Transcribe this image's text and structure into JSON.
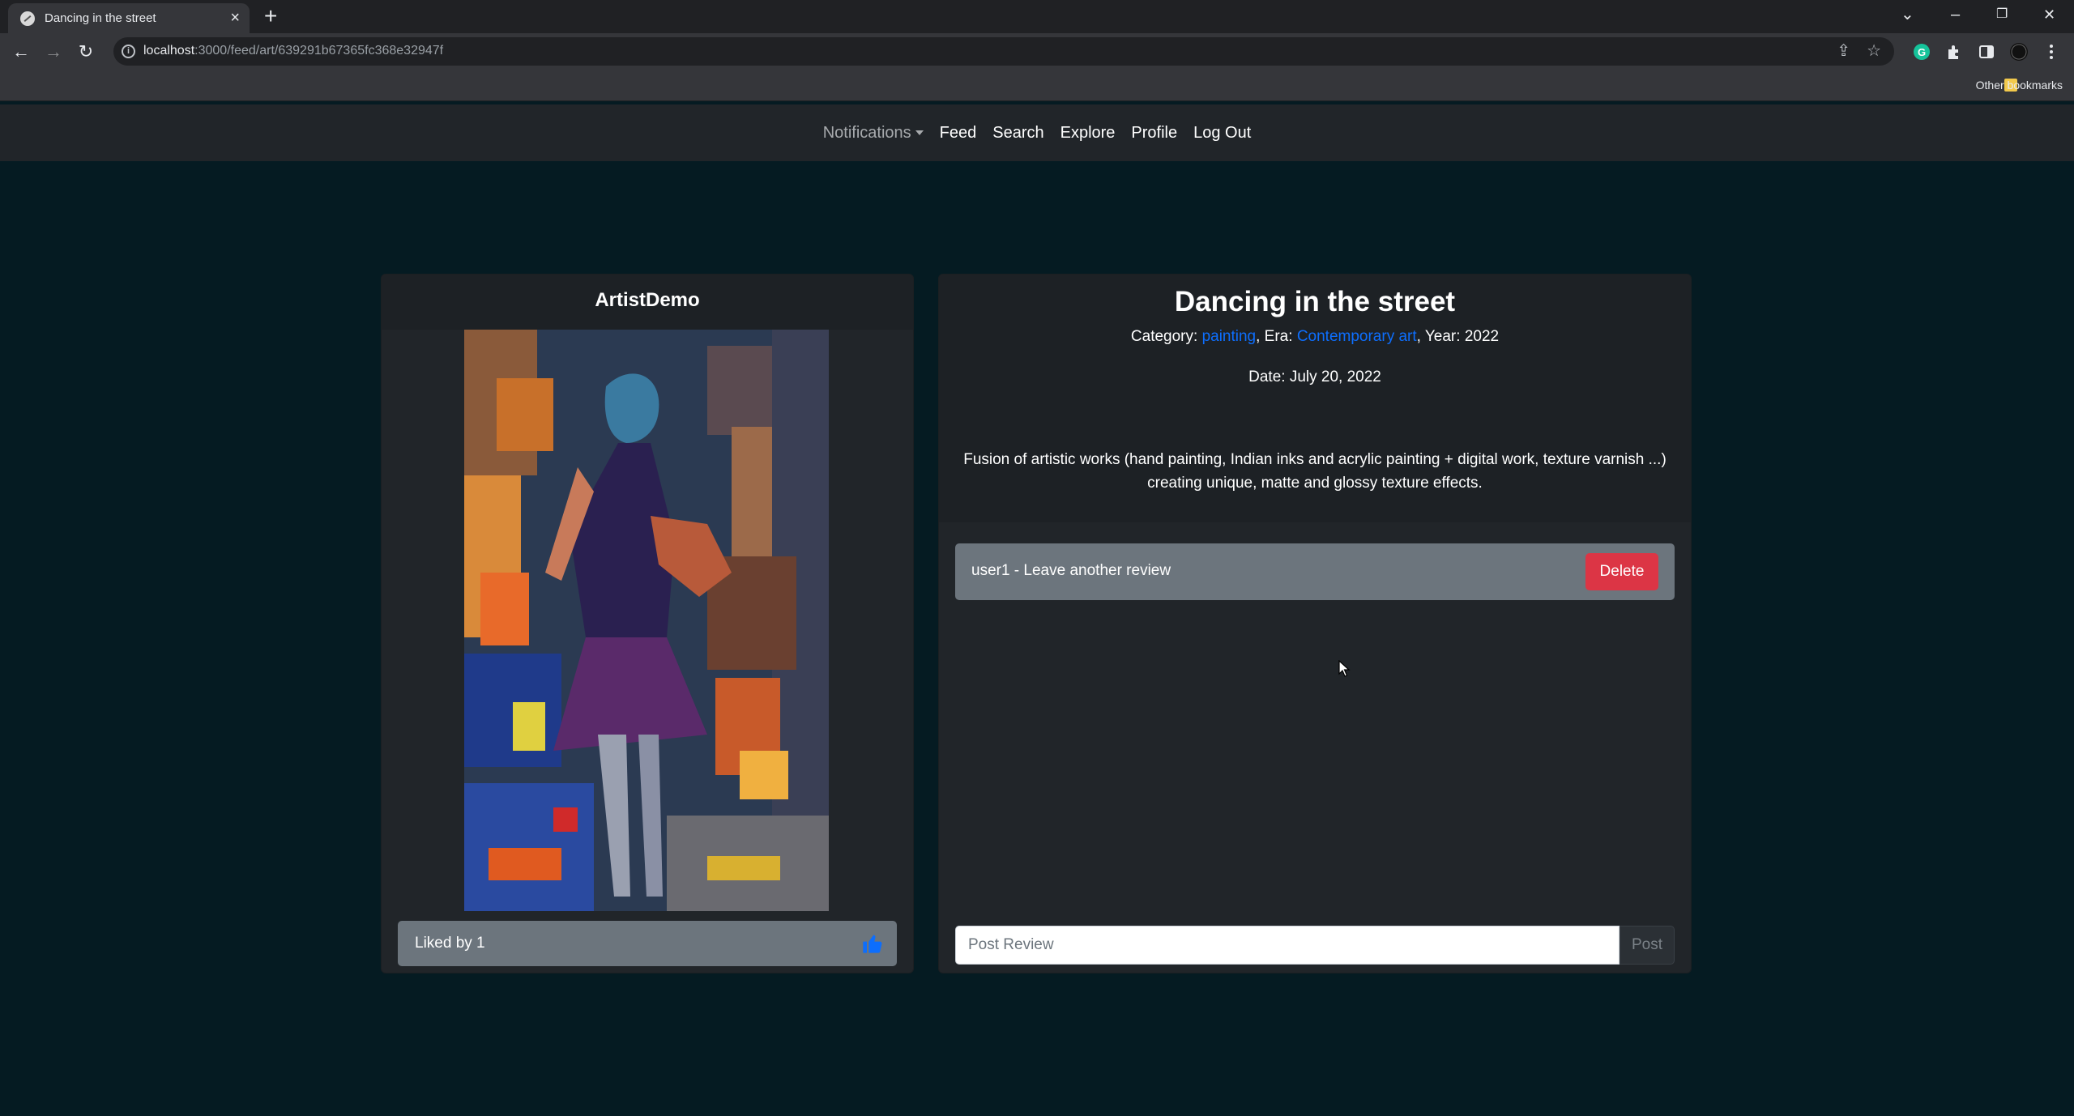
{
  "browser": {
    "tab_title": "Dancing in the street",
    "tab_close": "×",
    "new_tab": "+",
    "url_host": "localhost",
    "url_path": ":3000/feed/art/639291b67365fc368e32947f",
    "bookmarks_label": "Other bookmarks",
    "window_controls": {
      "minimize": "–",
      "maximize": "❐",
      "close": "✕",
      "tab_search": "⌄"
    },
    "nav": {
      "back": "←",
      "forward": "→",
      "reload": "↻"
    }
  },
  "navbar": {
    "notifications": "Notifications",
    "links": [
      "Feed",
      "Search",
      "Explore",
      "Profile",
      "Log Out"
    ]
  },
  "artwork": {
    "artist": "ArtistDemo",
    "liked_text": "Liked by 1",
    "title": "Dancing in the street",
    "category_label": "Category: ",
    "category": "painting",
    "era_label": ", Era: ",
    "era": "Contemporary art",
    "year_text": ", Year: 2022",
    "date_text": "Date: July 20, 2022",
    "description": "Fusion of artistic works (hand painting, Indian inks and acrylic painting + digital work, texture varnish ...) creating unique, matte and glossy texture effects."
  },
  "reviews": [
    {
      "text": "user1 - Leave another review",
      "delete_label": "Delete"
    }
  ],
  "review_form": {
    "placeholder": "Post Review",
    "value": "",
    "post_label": "Post"
  },
  "colors": {
    "page_bg": "#051b22",
    "card_bg": "#212529",
    "link": "#0d6efd",
    "danger": "#dc3545",
    "secondary": "#6c757d"
  }
}
